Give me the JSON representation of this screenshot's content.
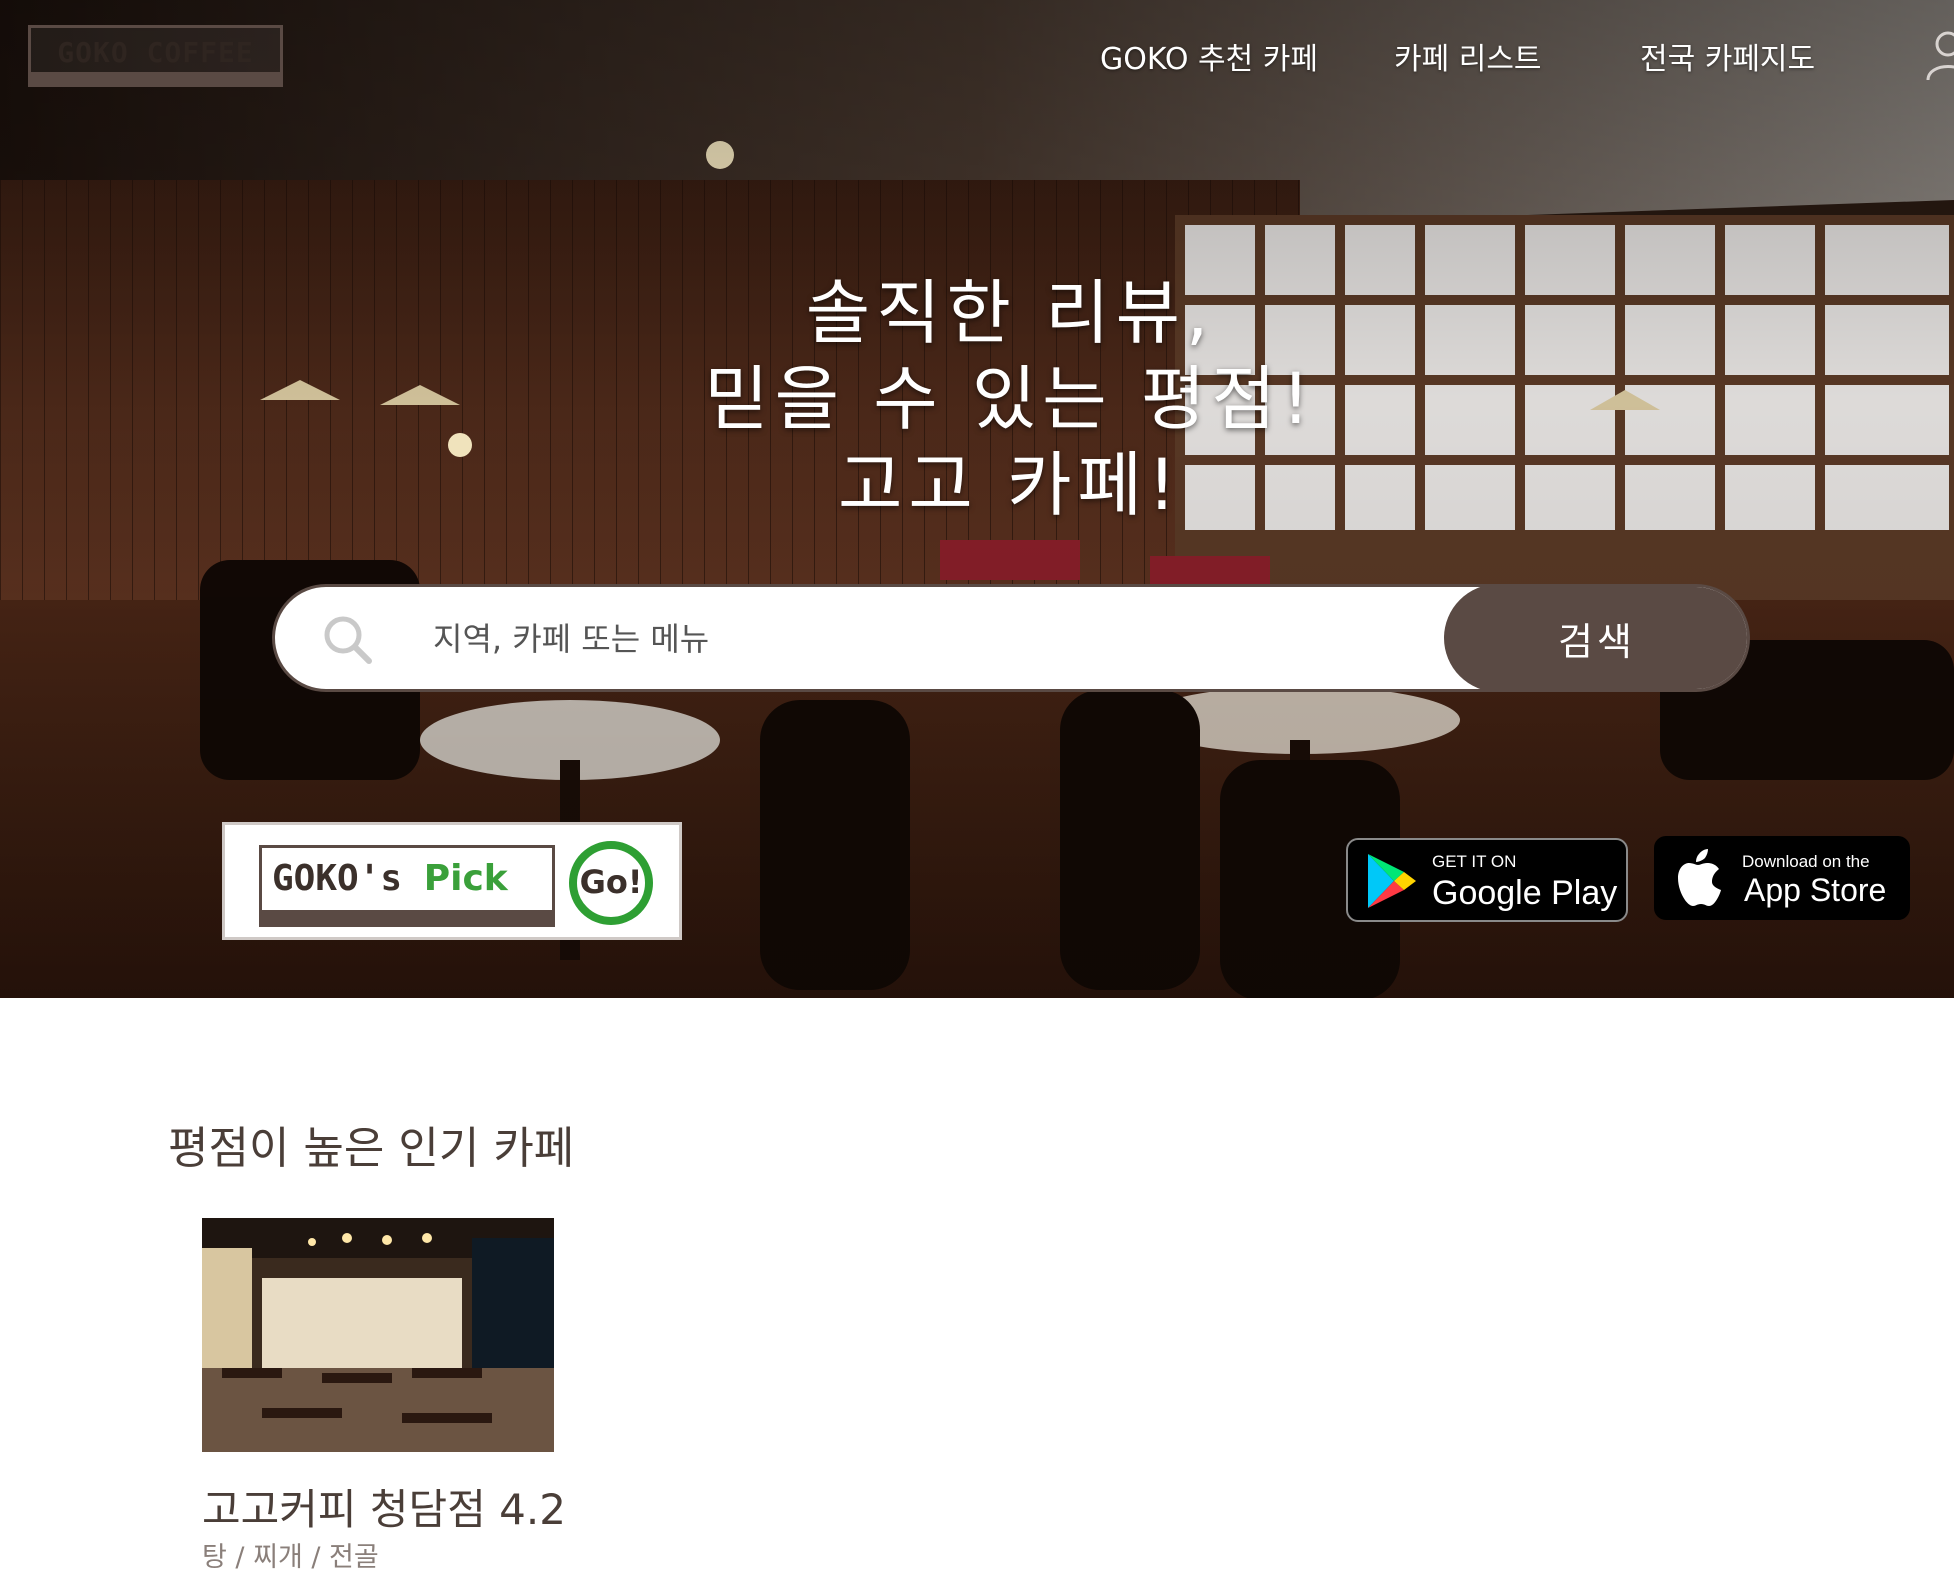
{
  "brand": {
    "logo_text": "GOKO COFFEE"
  },
  "nav": {
    "items": [
      {
        "label": "GOKO 추천 카페"
      },
      {
        "label": "카페 리스트"
      },
      {
        "label": "전국 카페지도"
      }
    ]
  },
  "hero": {
    "headline": [
      "솔직한 리뷰,",
      "믿을 수 있는 평점!",
      "고고 카페!"
    ]
  },
  "search": {
    "placeholder": "지역, 카페 또는 메뉴",
    "value": "",
    "button_label": "검색"
  },
  "promo": {
    "pick_prefix": "GOKO's ",
    "pick_accent": "Pick",
    "go_label": "Go!"
  },
  "app_badges": {
    "google": {
      "small": "GET IT ON",
      "big": "Google Play"
    },
    "apple": {
      "small": "Download on the",
      "big": "App Store"
    }
  },
  "popular": {
    "section_title": "평점이 높은 인기 카페",
    "cards": [
      {
        "title": "고고커피 청담점 4.2",
        "category": "탕 / 찌개 / 전골"
      }
    ]
  },
  "colors": {
    "brand_brown": "#5a4a44",
    "pick_green": "#3aa03a",
    "text_dark": "#4a3e38",
    "text_muted": "#8a7f7a"
  },
  "icons": [
    "user-icon",
    "search-icon",
    "google-play-icon",
    "apple-icon"
  ]
}
